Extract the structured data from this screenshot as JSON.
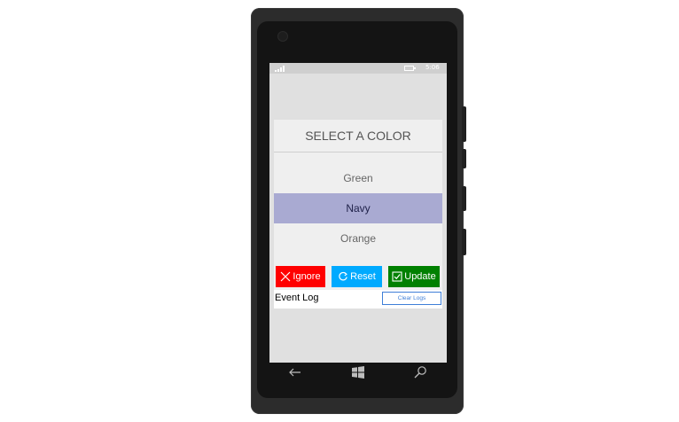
{
  "status_bar": {
    "time": "5:06"
  },
  "picker": {
    "title": "SELECT A COLOR",
    "items": [
      {
        "label": "Green",
        "selected": false
      },
      {
        "label": "Navy",
        "selected": true
      },
      {
        "label": "Orange",
        "selected": false
      }
    ],
    "selected_color": "#a9aad2"
  },
  "buttons": {
    "ignore": {
      "label": "Ignore",
      "color": "#ff0000"
    },
    "reset": {
      "label": "Reset",
      "color": "#00aaff"
    },
    "update": {
      "label": "Update",
      "color": "#008000"
    }
  },
  "event_log": {
    "label": "Event Log",
    "clear_label": "Clear Logs"
  },
  "nav_bar": {
    "icons": [
      "back-icon",
      "windows-start-icon",
      "search-icon"
    ]
  }
}
